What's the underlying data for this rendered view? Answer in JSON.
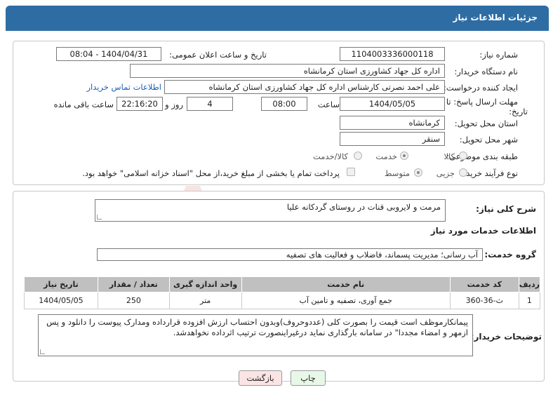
{
  "header": {
    "title": "جزئیات اطلاعات نیاز"
  },
  "fields": {
    "need_number_label": "شماره نیاز:",
    "need_number": "1104003336000118",
    "announce_label": "تاریخ و ساعت اعلان عمومی:",
    "announce_value": "1404/04/31 - 08:04",
    "buyer_org_label": "نام دستگاه خریدار:",
    "buyer_org": "اداره کل جهاد کشاورزی استان کرمانشاه",
    "requester_label": "ایجاد کننده درخواست:",
    "requester": "علی احمد نصرتی کارشناس اداره کل جهاد کشاورزی استان کرمانشاه",
    "contact_link": "اطلاعات تماس خریدار",
    "deadline_label_1": "مهلت ارسال پاسخ: تا",
    "deadline_label_2": "تاریخ:",
    "deadline_date": "1404/05/05",
    "time_label": "ساعت",
    "deadline_time": "08:00",
    "days_value": "4",
    "days_label": "روز و",
    "remaining_time": "22:16:20",
    "remaining_label": "ساعت باقی مانده",
    "province_label": "استان محل تحویل:",
    "province": "کرمانشاه",
    "city_label": "شهر محل تحویل:",
    "city": "سنقر",
    "category_label": "طبقه بندی موضوعی:",
    "category_options": [
      "کالا",
      "خدمت",
      "کالا/خدمت"
    ],
    "purchase_type_label": "نوع فرآیند خرید :",
    "purchase_options": [
      "جزیی",
      "متوسط"
    ],
    "payment_note": "پرداخت تمام یا بخشی از مبلغ خرید،از محل \"اسناد خزانه اسلامی\" خواهد بود."
  },
  "description": {
    "label": "شرح کلی نیاز:",
    "value": "مرمت و لایروبی قنات در روستای گردکانه علیا"
  },
  "services": {
    "section_title": "اطلاعات خدمات مورد نیاز",
    "group_label": "گروه خدمت:",
    "group_value": "آب رسانی؛ مدیریت پسماند، فاضلاب و فعالیت های تصفیه",
    "columns": [
      "ردیف",
      "کد خدمت",
      "نام خدمت",
      "واحد اندازه گیری",
      "تعداد / مقدار",
      "تاریخ نیاز"
    ],
    "rows": [
      [
        "1",
        "ث-36-360",
        "جمع آوری، تصفیه و تامین آب",
        "متر",
        "250",
        "1404/05/05"
      ]
    ]
  },
  "buyer_notes": {
    "label": "توضیحات خریدار:",
    "value": "پیمانکارموظف است قیمت را بصورت کلی (عددوحروف)وبدون احتساب ارزش افزوده قرارداده ومدارک پیوست را دانلود و پس ازمهر و امضاء مجددا\"  در سامانه بارگذاری نماید درغیراینصورت ترتیب اثرداده نخواهدشد."
  },
  "buttons": {
    "print": "چاپ",
    "back": "بازگشت"
  },
  "watermark": {
    "text": "AriaTender.neT"
  },
  "colors": {
    "header_bg": "#2e6da4",
    "link": "#1a5fb4",
    "table_header": "#c0c0c0",
    "print_bg": "#e8f8e8",
    "back_bg": "#fbe4e4"
  }
}
